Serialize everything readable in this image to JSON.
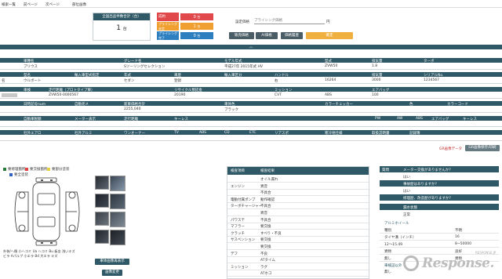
{
  "topnav": {
    "items": [
      "検索一覧",
      "前ページ",
      "次ページ",
      "部位画像"
    ]
  },
  "summary": {
    "card_title": "全国出品件数合計（台）",
    "card_value": "1",
    "card_unit": "台",
    "status_rows": [
      {
        "label": "成約",
        "value": "0",
        "unit": "台",
        "color": "#e0484b"
      },
      {
        "label": "プライシング未定",
        "value": "1",
        "unit": "台",
        "color": "#f0a030"
      },
      {
        "label": "プライシング完了",
        "value": "0",
        "unit": "台",
        "color": "#2d7fc0"
      }
    ],
    "price_label": "設定価格",
    "price_placeholder": "プライシング価格",
    "price_unit": "円",
    "buttons": [
      "販売価格",
      "AI価格",
      "価格履歴",
      "確定"
    ]
  },
  "spec_table": {
    "header1": [
      "車種名",
      "グレード名",
      "モデル年式",
      "型式",
      "排気量",
      "ターボ"
    ],
    "row1": [
      "プリウス",
      "Sツーリングセレクション",
      "平成27年 2015年式 HV",
      "ZVW50",
      "1.8",
      ""
    ],
    "header2": [
      "型名",
      "輸入車型式指定",
      "年式",
      "車歴",
      "輸入車区分",
      "ハンドル",
      "排気量",
      "シリアルNo."
    ],
    "row2": [
      "名",
      "ウルボート",
      "セダン",
      "登録",
      "右",
      "16264",
      "3000",
      "1234567"
    ],
    "header3": [
      "車検",
      "走行距離（プロトタイプ車）",
      "リサイクル預託金",
      "ミッション",
      "エアバッグ"
    ],
    "row3": [
      "",
      "ZVW50-0000567",
      "20190",
      "CVT",
      "ABS",
      "100"
    ],
    "header4": [
      "日時記号num",
      "自動売メ",
      "新車価格合計",
      "車体色",
      "カラーチェッカー",
      "色",
      "カラーコード"
    ],
    "row4": [
      "",
      "",
      "2255,040",
      "ブラック",
      "",
      "",
      ""
    ],
    "header5": [
      "自動車税額",
      "メーター表示",
      "走行距離",
      "キーレス",
      "PW",
      "AW",
      "ABS",
      "エアバッグ",
      "キーレス"
    ],
    "header6": [
      "社外エアロ",
      "社外アルミ",
      "ワンオーナー",
      "TV",
      "ABS",
      "CD",
      "ETC",
      "リアスポ",
      "寒冷地仕様",
      "取扱説明書",
      "記録簿"
    ],
    "actions": [
      "GR画像データ",
      "GR画像保存/印刷"
    ]
  },
  "legend": {
    "items": [
      "要修理箇所",
      "要交換箇所",
      "要部分塗装",
      "要全塗装"
    ]
  },
  "damage_note": "外装/ヘ傷 小ヘコミ Ua ヘコミ Bu 板金 浅いキズ\nビラ Aパルプ 小エラ Bd 大エラ キズ",
  "photo_buttons": [
    "車体画像再表示",
    "画像変更"
  ],
  "condition_panel": {
    "headers": [
      "検査項目",
      "検査結果"
    ],
    "rows": [
      {
        "item": "",
        "result": "オイル漏れ"
      },
      {
        "item": "エンジン",
        "result": "異音"
      },
      {
        "item": "",
        "result": "不具合"
      },
      {
        "item": "電動付属ポンプ",
        "result": "動作確認"
      },
      {
        "item": "ターボチャージャー",
        "result": "不具合"
      },
      {
        "item": "",
        "result": "異音"
      },
      {
        "item": "パワステ",
        "result": "不具合"
      },
      {
        "item": "マフラー",
        "result": "要交換"
      },
      {
        "item": "クラッチ",
        "result": "すべり・不良"
      },
      {
        "item": "サスペンション",
        "result": "要交換"
      },
      {
        "item": "",
        "result": "要交換"
      },
      {
        "item": "デフ",
        "result": "不良"
      },
      {
        "item": "",
        "result": "ATタイム"
      },
      {
        "item": "ミッション",
        "result": "ラグ"
      },
      {
        "item": "",
        "result": "ATホコ"
      }
    ]
  },
  "right_panel": {
    "title": "質問",
    "q1": "メーター交換がありませんか？",
    "a1": "はい",
    "q2": "事故歴はありますか？",
    "a2": "はい",
    "q3": "修理歴、改造歴がありますか？",
    "a3": "",
    "q4": "漏水状態",
    "a4": "正常",
    "section2": "アルミホイール",
    "rows2": [
      {
        "label": "種別",
        "value": "不明"
      },
      {
        "label": "タイヤ溝（インチ）",
        "value": "16"
      },
      {
        "label": "12〜15.49",
        "value": "8~50000"
      },
      {
        "label": "異物",
        "value": "良好"
      },
      {
        "label": "無し",
        "value": "異物"
      }
    ],
    "section3": "車検証以外",
    "rows3": [
      {
        "label": "無し",
        "value": ""
      }
    ]
  },
  "watermark": "Response.",
  "watermark_sub": "RESPONSE.JP"
}
